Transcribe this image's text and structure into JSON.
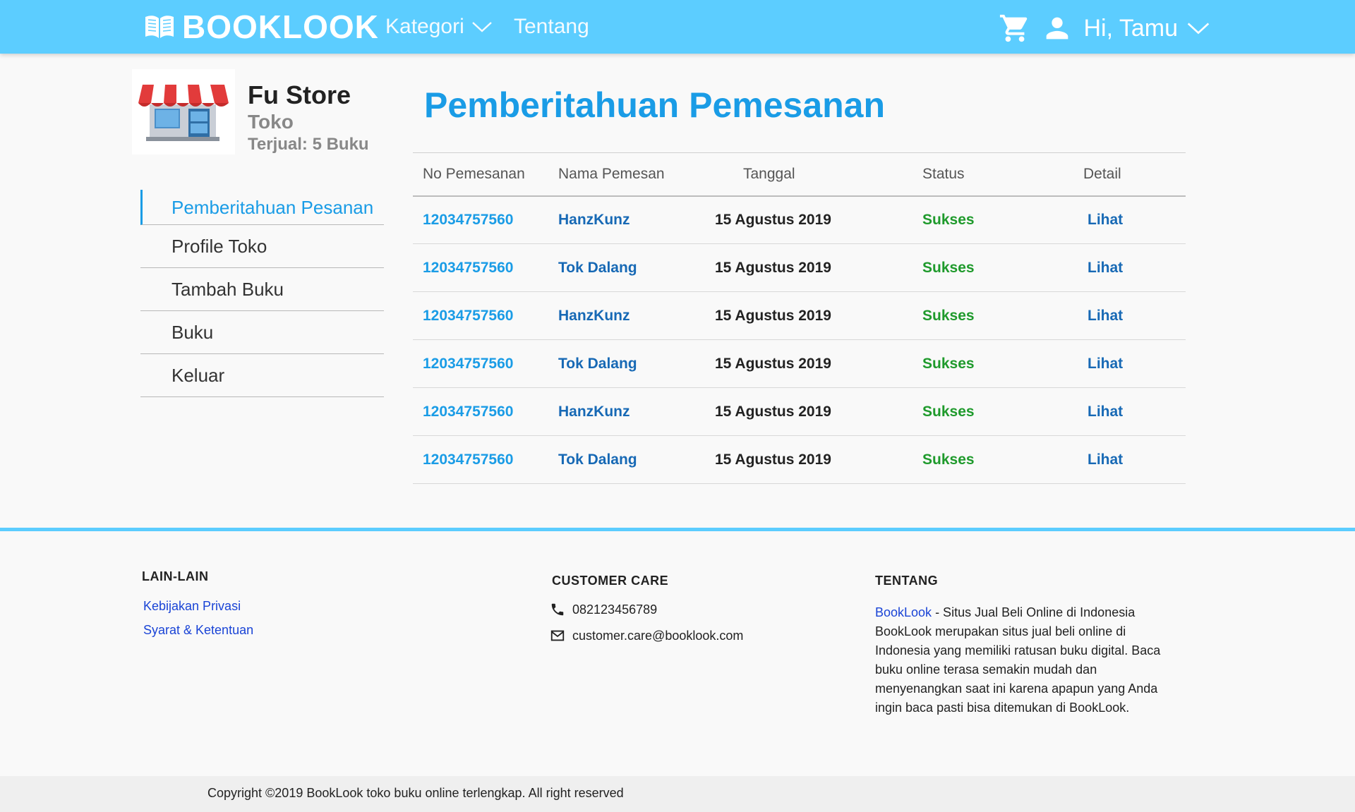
{
  "navbar": {
    "brand": "BOOKLOOK",
    "kategori": "Kategori",
    "tentang": "Tentang",
    "greeting": "Hi, Tamu"
  },
  "store": {
    "name": "Fu Store",
    "type": "Toko",
    "sold": "Terjual: 5 Buku"
  },
  "sidebar": {
    "items": [
      {
        "label": "Pemberitahuan Pesanan"
      },
      {
        "label": "Profile Toko"
      },
      {
        "label": "Tambah Buku"
      },
      {
        "label": "Buku"
      },
      {
        "label": "Keluar"
      }
    ]
  },
  "main": {
    "title": "Pemberitahuan Pemesanan",
    "columns": [
      "No Pemesanan",
      "Nama Pemesan",
      "Tanggal",
      "Status",
      "Detail"
    ],
    "rows": [
      {
        "no": "12034757560",
        "nama": "HanzKunz",
        "tanggal": "15 Agustus 2019",
        "status": "Sukses",
        "detail": "Lihat"
      },
      {
        "no": "12034757560",
        "nama": "Tok Dalang",
        "tanggal": "15 Agustus 2019",
        "status": "Sukses",
        "detail": "Lihat"
      },
      {
        "no": "12034757560",
        "nama": "HanzKunz",
        "tanggal": "15 Agustus 2019",
        "status": "Sukses",
        "detail": "Lihat"
      },
      {
        "no": "12034757560",
        "nama": "Tok Dalang",
        "tanggal": "15 Agustus 2019",
        "status": "Sukses",
        "detail": "Lihat"
      },
      {
        "no": "12034757560",
        "nama": "HanzKunz",
        "tanggal": "15 Agustus 2019",
        "status": "Sukses",
        "detail": "Lihat"
      },
      {
        "no": "12034757560",
        "nama": "Tok Dalang",
        "tanggal": "15 Agustus 2019",
        "status": "Sukses",
        "detail": "Lihat"
      }
    ]
  },
  "footer": {
    "lain_lain": {
      "heading": "LAIN-LAIN",
      "links": [
        "Kebijakan Privasi",
        "Syarat & Ketentuan"
      ]
    },
    "customer_care": {
      "heading": "CUSTOMER CARE",
      "phone": "082123456789",
      "email": "customer.care@booklook.com"
    },
    "tentang": {
      "heading": "TENTANG",
      "brand_link": "BookLook",
      "text": " - Situs Jual Beli Online di Indonesia BookLook merupakan situs jual beli online di Indonesia yang memiliki ratusan buku digital. Baca buku online terasa semakin mudah dan menyenangkan saat ini karena apapun yang Anda ingin baca pasti bisa ditemukan di BookLook."
    },
    "copyright": "Copyright ©2019 BookLook toko buku online terlengkap. All right reserved"
  },
  "icons": [
    "book-icon",
    "chevron-down-icon",
    "cart-icon",
    "user-icon",
    "store-icon",
    "phone-icon",
    "mail-icon"
  ],
  "colors": {
    "navbar": "#5ccdff",
    "accent": "#1a9ce6",
    "link": "#1769b5",
    "success": "#1f9a2c",
    "footer_link": "#1a44d6"
  }
}
